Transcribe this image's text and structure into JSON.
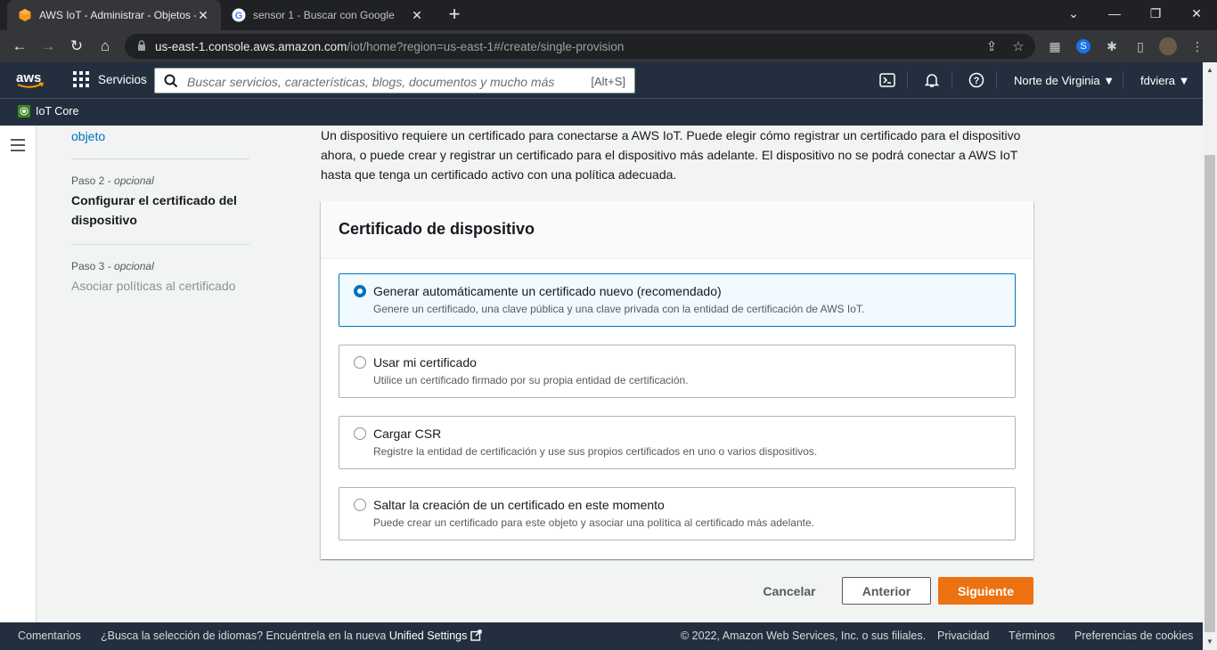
{
  "browser": {
    "tabs": [
      {
        "title": "AWS IoT - Administrar - Objetos -",
        "favicon": "aws-icon",
        "active": true
      },
      {
        "title": "sensor 1 - Buscar con Google",
        "favicon": "google-icon",
        "active": false
      }
    ],
    "url_host": "us-east-1.console.aws.amazon.com",
    "url_path": "/iot/home?region=us-east-1#/create/single-provision"
  },
  "aws_header": {
    "services_label": "Servicios",
    "search_placeholder": "Buscar servicios, características, blogs, documentos y mucho más",
    "search_shortcut": "[Alt+S]",
    "region": "Norte de Virginia ▼",
    "user": "fdviera ▼",
    "service_name": "IoT Core"
  },
  "steps": {
    "prev_link": "objeto",
    "step2_label": "Paso 2 -",
    "step2_opt": "opcional",
    "step2_title": "Configurar el certificado del dispositivo",
    "step3_label": "Paso 3 -",
    "step3_opt": "opcional",
    "step3_title": "Asociar políticas al certificado"
  },
  "intro": "Un dispositivo requiere un certificado para conectarse a AWS IoT. Puede elegir cómo registrar un certificado para el dispositivo ahora, o puede crear y registrar un certificado para el dispositivo más adelante. El dispositivo no se podrá conectar a AWS IoT hasta que tenga un certificado activo con una política adecuada.",
  "card": {
    "title": "Certificado de dispositivo",
    "options": [
      {
        "title": "Generar automáticamente un certificado nuevo (recomendado)",
        "desc": "Genere un certificado, una clave pública y una clave privada con la entidad de certificación de AWS IoT.",
        "selected": true
      },
      {
        "title": "Usar mi certificado",
        "desc": "Utilice un certificado firmado por su propia entidad de certificación.",
        "selected": false
      },
      {
        "title": "Cargar CSR",
        "desc": "Registre la entidad de certificación y use sus propios certificados en uno o varios dispositivos.",
        "selected": false
      },
      {
        "title": "Saltar la creación de un certificado en este momento",
        "desc": "Puede crear un certificado para este objeto y asociar una política al certificado más adelante.",
        "selected": false
      }
    ]
  },
  "actions": {
    "cancel": "Cancelar",
    "previous": "Anterior",
    "next": "Siguiente"
  },
  "footer": {
    "feedback": "Comentarios",
    "lang_note": "¿Busca la selección de idiomas? Encuéntrela en la nueva",
    "unified": "Unified Settings",
    "copyright": "© 2022, Amazon Web Services, Inc. o sus filiales.",
    "privacy": "Privacidad",
    "terms": "Términos",
    "cookies": "Preferencias de cookies"
  },
  "colors": {
    "aws_nav": "#232f3e",
    "primary": "#ec7211",
    "link": "#0073bb"
  }
}
